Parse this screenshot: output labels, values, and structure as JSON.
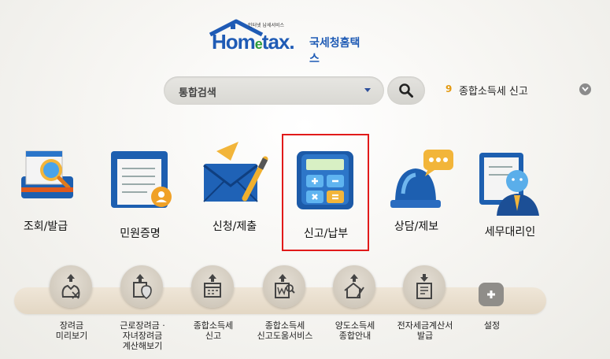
{
  "logo": {
    "small_text": "인터넷 납세서비스",
    "brand": "Hometax",
    "brand_e": "e",
    "korean": "국세청홈택스"
  },
  "search": {
    "select_value": "통합검색",
    "button_icon": "search-icon"
  },
  "popular": {
    "rank": "9",
    "text": "종합소득세 신고",
    "toggle_icon": "chevron-down-icon"
  },
  "main_menu": [
    {
      "label": "조회/발급",
      "icon": "lookup-document-magnifier-icon"
    },
    {
      "label": "민원증명",
      "icon": "certificate-document-icon"
    },
    {
      "label": "신청/제출",
      "icon": "envelope-pen-icon"
    },
    {
      "label": "신고/납부",
      "icon": "calculator-icon"
    },
    {
      "label": "상담/제보",
      "icon": "siren-speech-bubble-icon"
    },
    {
      "label": "세무대리인",
      "icon": "tax-agent-person-icon"
    }
  ],
  "selected_menu": "신고/납부",
  "quick_menu": [
    {
      "label": "장려금\n미리보기",
      "icon": "incentive-preview-icon"
    },
    {
      "label": "근로장려금 ·\n자녀장려금\n계산해보기",
      "icon": "incentive-calculate-icon"
    },
    {
      "label": "종합소득세\n신고",
      "icon": "calendar-report-icon"
    },
    {
      "label": "종합소득세\n신고도움서비스",
      "icon": "won-document-search-icon"
    },
    {
      "label": "양도소득세\n종합안내",
      "icon": "house-pen-icon"
    },
    {
      "label": "전자세금계산서\n발급",
      "icon": "tax-invoice-icon"
    },
    {
      "label": "설정",
      "icon": "plus-icon"
    }
  ],
  "colors": {
    "brand_blue": "#1f5bb5",
    "selected_border": "#e11a1a",
    "rank_orange": "#e39a12"
  }
}
